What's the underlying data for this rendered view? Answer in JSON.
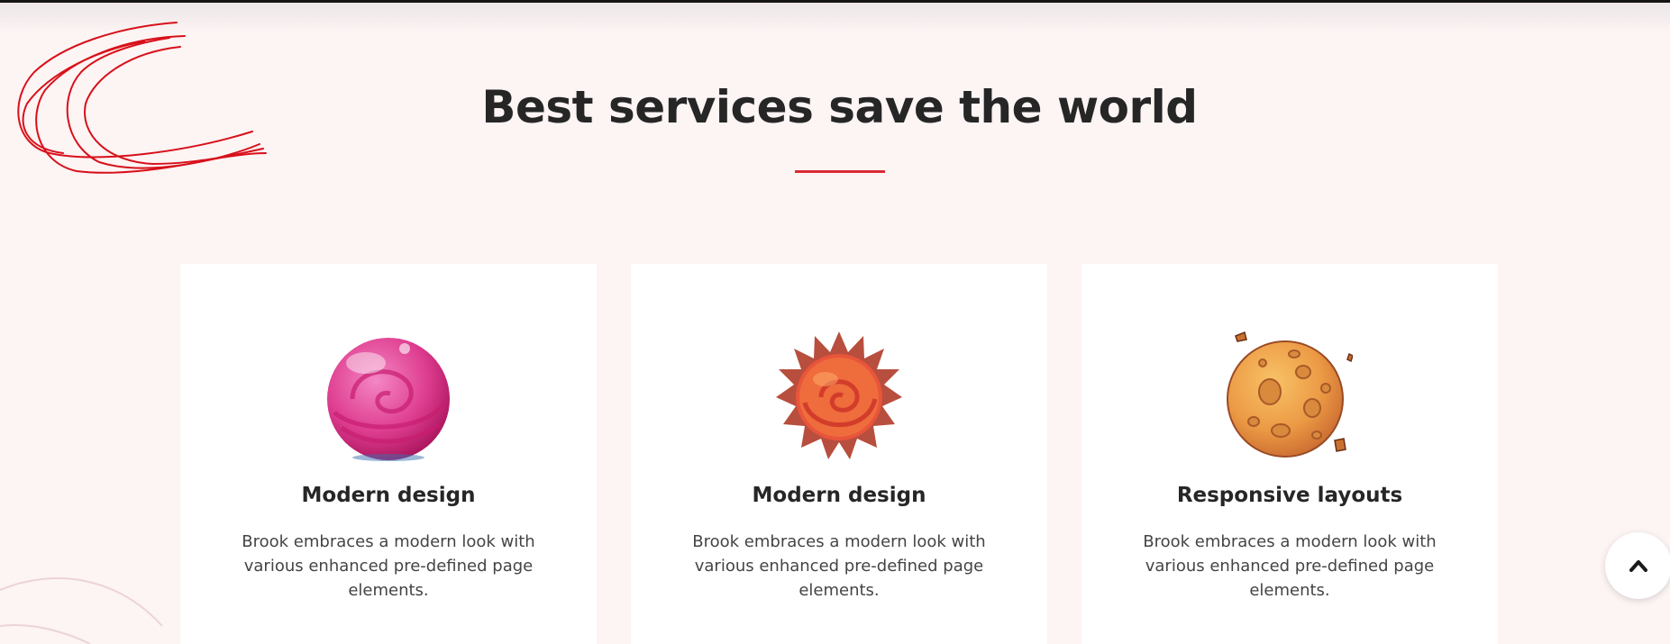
{
  "section": {
    "title": "Best services save the world",
    "accent_color": "#d92b33"
  },
  "cards": [
    {
      "icon": "pink-planet-icon",
      "title": "Modern design",
      "text": "Brook embraces a modern look with various enhanced pre-defined page elements."
    },
    {
      "icon": "sun-planet-icon",
      "title": "Modern design",
      "text": "Brook embraces a modern look with various enhanced pre-defined page elements."
    },
    {
      "icon": "cratered-planet-icon",
      "title": "Responsive layouts",
      "text": "Brook embraces a modern look with various enhanced pre-defined page elements."
    }
  ],
  "scroll_top": {
    "icon": "chevron-up-icon"
  }
}
